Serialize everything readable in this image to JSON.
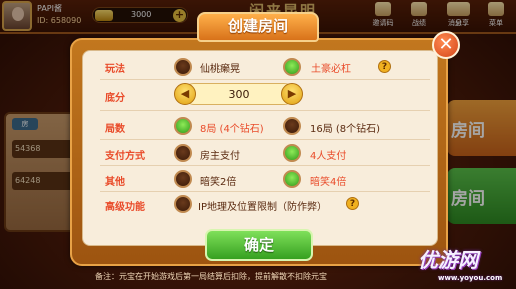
{
  "topbar": {
    "username": "PAPI酱",
    "user_id": "ID: 658090",
    "gold": "3000",
    "gold_plus": "+",
    "logo": "闲来昆明"
  },
  "nav": [
    {
      "label": "邀请码"
    },
    {
      "label": "战绩"
    },
    {
      "label": "消息"
    },
    {
      "label": "分享"
    },
    {
      "label": "菜单"
    }
  ],
  "background": {
    "room_ids": [
      "54368",
      "64248"
    ],
    "chip": "房",
    "big_buttons": [
      "房间",
      "房间"
    ]
  },
  "dialog": {
    "title": "创建房间",
    "close": "✕",
    "rows": {
      "gameplay": {
        "label": "玩法",
        "options": [
          "仙桃癞晃",
          "土豪必杠"
        ],
        "help": "?"
      },
      "base": {
        "label": "底分",
        "value": "300",
        "dec": "◀",
        "inc": "▶"
      },
      "rounds": {
        "label": "局数",
        "options": [
          "8局 (4个钻石)",
          "16局 (8个钻石)"
        ]
      },
      "payment": {
        "label": "支付方式",
        "options": [
          "房主支付",
          "4人支付"
        ]
      },
      "other": {
        "label": "其他",
        "options": [
          "暗笑2倍",
          "暗笑4倍"
        ]
      },
      "advanced": {
        "label": "高级功能",
        "options": [
          "IP地理及位置限制（防作弊）"
        ],
        "help": "?"
      }
    },
    "confirm": "确定",
    "note": "备注：元宝在开始游戏后第一局结算后扣除，提前解散不扣除元宝"
  },
  "watermark": {
    "text": "优游网",
    "url": "www.yoyou.com"
  },
  "colors": {
    "label": "#e94b2a",
    "selected": "#2e9a1a",
    "frame": "#c2771e"
  }
}
